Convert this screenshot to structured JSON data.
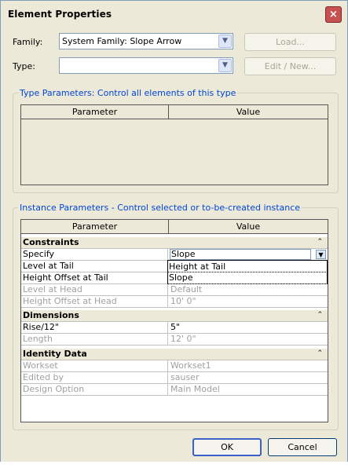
{
  "window": {
    "title": "Element Properties",
    "close_icon": "×"
  },
  "top": {
    "family_label": "Family:",
    "family_value": "System Family: Slope Arrow",
    "type_label": "Type:",
    "type_value": "",
    "load_button": "Load...",
    "edit_new_button": "Edit / New..."
  },
  "type_params": {
    "title": "Type Parameters: Control all elements of this type",
    "col_parameter": "Parameter",
    "col_value": "Value"
  },
  "instance_params": {
    "title": "Instance Parameters - Control selected or to-be-created instance",
    "col_parameter": "Parameter",
    "col_value": "Value",
    "groups": [
      {
        "name": "Constraints",
        "rows": [
          {
            "param": "Specify",
            "value": "Slope",
            "enabled": true
          },
          {
            "param": "Level at Tail",
            "value": "",
            "enabled": true
          },
          {
            "param": "Height Offset at Tail",
            "value": "",
            "enabled": true
          },
          {
            "param": "Level at Head",
            "value": "Default",
            "enabled": false
          },
          {
            "param": "Height Offset at Head",
            "value": "10'  0\"",
            "enabled": false
          }
        ]
      },
      {
        "name": "Dimensions",
        "rows": [
          {
            "param": "Rise/12\"",
            "value": "5\"",
            "enabled": true
          },
          {
            "param": "Length",
            "value": "12'  0\"",
            "enabled": false
          }
        ]
      },
      {
        "name": "Identity Data",
        "rows": [
          {
            "param": "Workset",
            "value": "Workset1",
            "enabled": false
          },
          {
            "param": "Edited by",
            "value": "sauser",
            "enabled": false
          },
          {
            "param": "Design Option",
            "value": "Main Model",
            "enabled": false
          }
        ]
      }
    ],
    "dropdown_options": [
      "Height at Tail",
      "Slope"
    ]
  },
  "buttons": {
    "ok": "OK",
    "cancel": "Cancel"
  },
  "icons": {
    "combo_arrow": "chevron-down-icon",
    "collapse": "collapse-icon"
  }
}
